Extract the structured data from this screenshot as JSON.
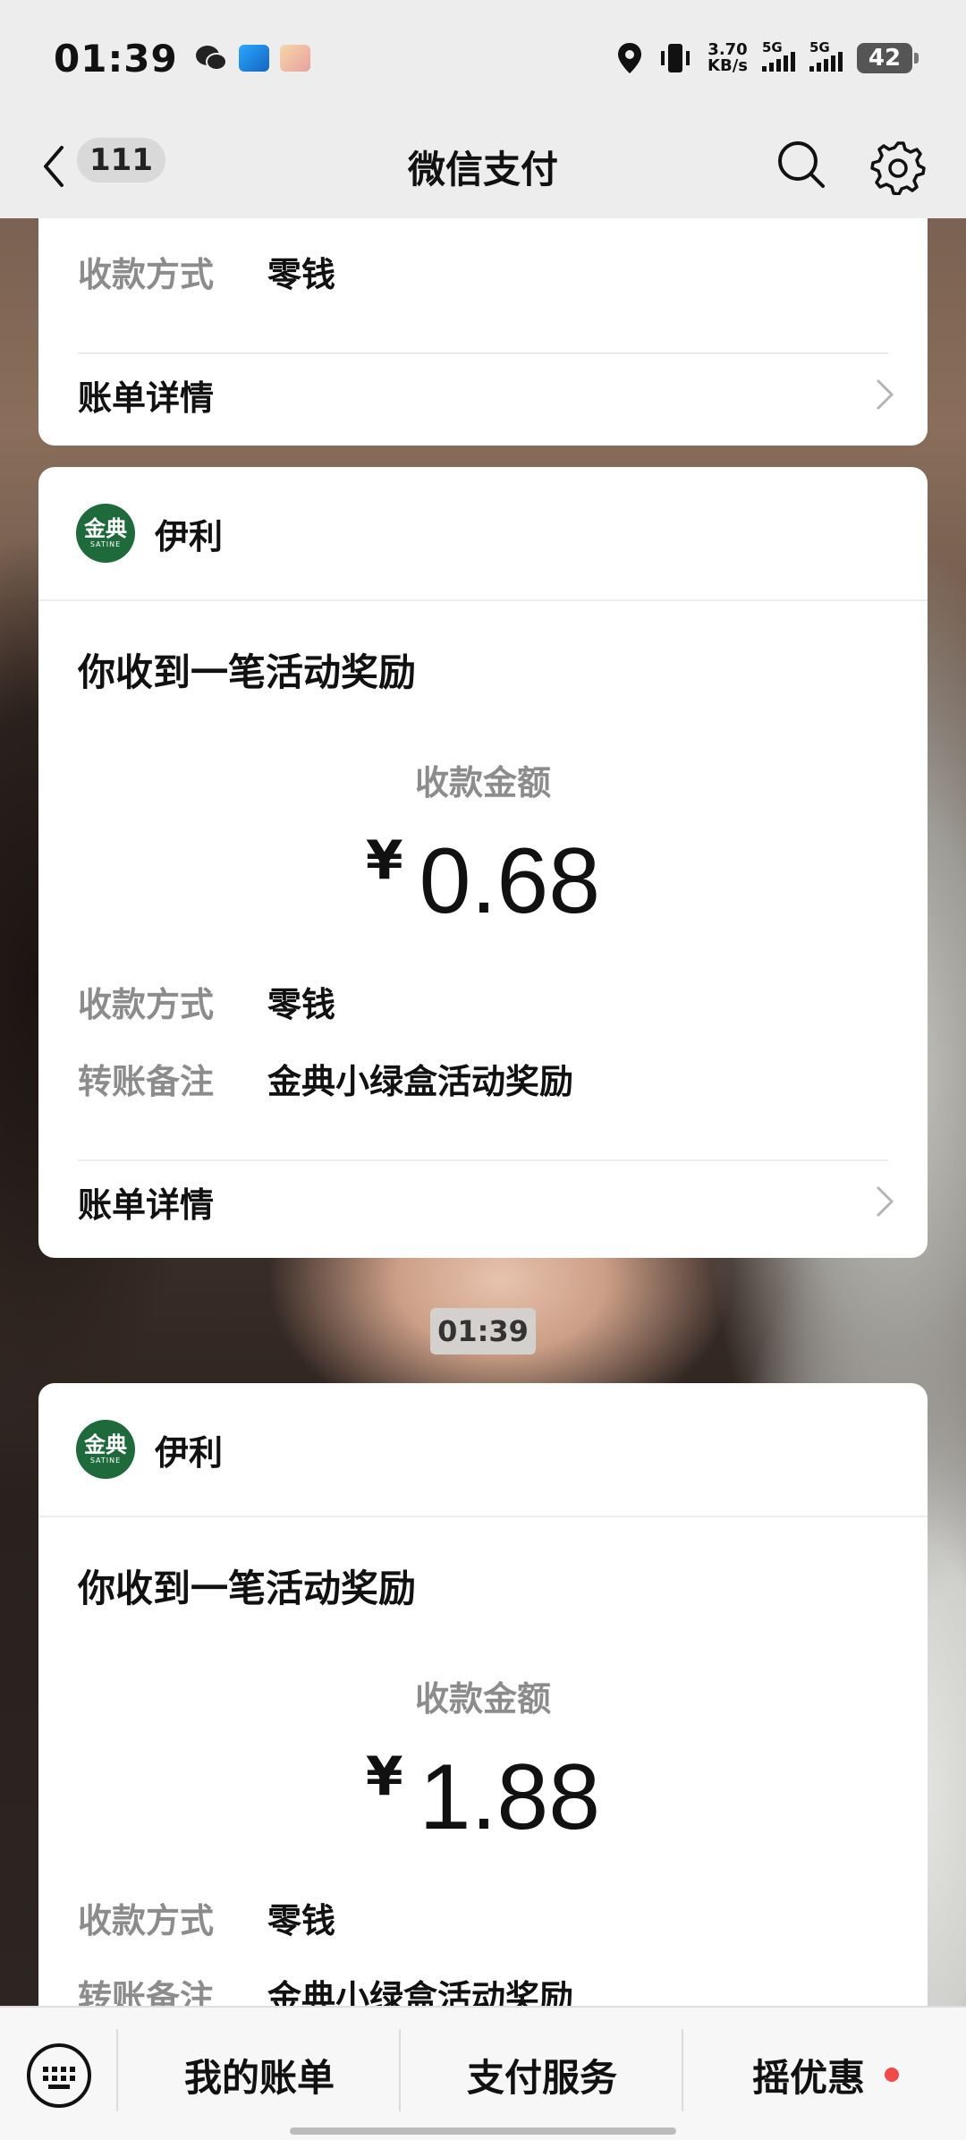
{
  "status_bar": {
    "time": "01:39",
    "speed_value": "3.70",
    "speed_unit": "KB/s",
    "signal1_label": "5G",
    "signal2_label": "5G",
    "battery": "42"
  },
  "nav": {
    "back_badge": "111",
    "title": "微信支付"
  },
  "cards": [
    {
      "method_label": "收款方式",
      "method_value": "零钱",
      "bill_details": "账单详情"
    },
    {
      "merchant": "伊利",
      "logo_text": "金典",
      "logo_sub": "SATINE",
      "title": "你收到一笔活动奖励",
      "amount_label": "收款金额",
      "currency": "¥",
      "amount": "0.68",
      "method_label": "收款方式",
      "method_value": "零钱",
      "note_label": "转账备注",
      "note_value": "金典小绿盒活动奖励",
      "bill_details": "账单详情"
    },
    {
      "merchant": "伊利",
      "logo_text": "金典",
      "logo_sub": "SATINE",
      "title": "你收到一笔活动奖励",
      "amount_label": "收款金额",
      "currency": "¥",
      "amount": "1.88",
      "method_label": "收款方式",
      "method_value": "零钱",
      "note_label": "转账备注",
      "note_value": "金典小绿盒活动奖励"
    }
  ],
  "timestamp": "01:39",
  "bottom_bar": {
    "tab1": "我的账单",
    "tab2": "支付服务",
    "tab3": "摇优惠"
  },
  "colors": {
    "logo_green": "#1f6a3b",
    "notification_red": "#f04a4a"
  }
}
